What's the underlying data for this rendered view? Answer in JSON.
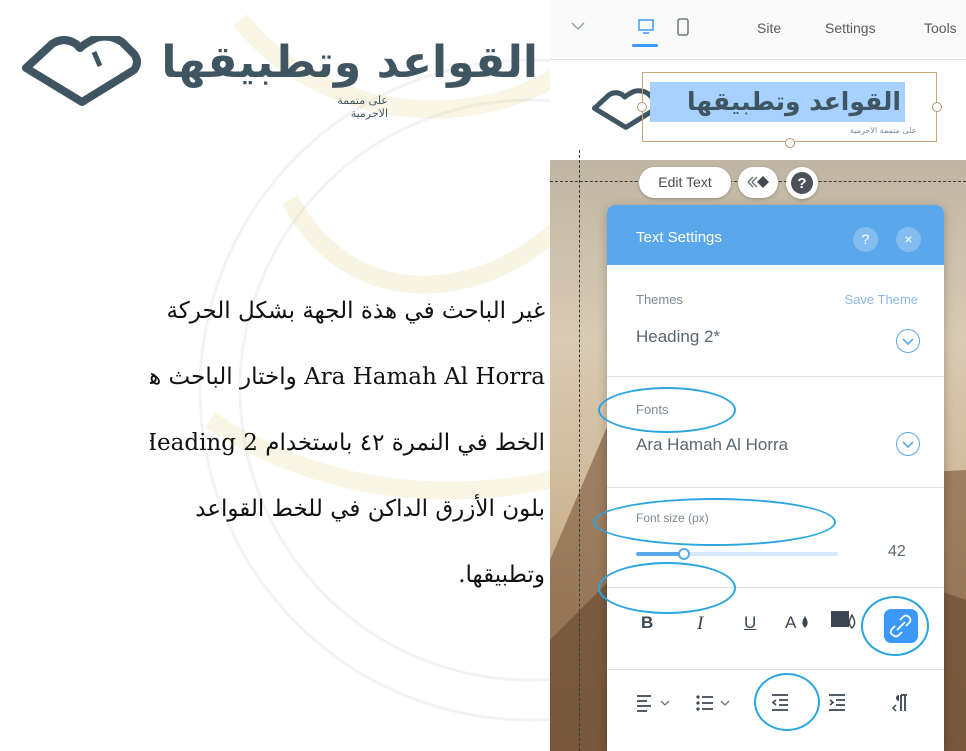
{
  "logo": {
    "title": "القواعد وتطبيقها",
    "subtitle": "على متممة الاجرمية"
  },
  "paragraph": {
    "line1": "غير الباحث في هذة الجهة بشكل الحركة",
    "line2": "Ara Hamah Al Horra واختار الباحث هجم",
    "line3": "الخط في النمرة ٤٢ باستخدام Heading 2.",
    "line4": "بلون الأزرق الداكن في للخط القواعد",
    "line5": "وتطبيقها."
  },
  "topbar": {
    "menu": [
      "Site",
      "Settings",
      "Tools"
    ]
  },
  "canvas": {
    "selected_text": "القواعد وتطبيقها",
    "selected_sub": "على متممة الاجرمية"
  },
  "toolbar_pills": {
    "edit_text": "Edit Text",
    "help": "?"
  },
  "panel": {
    "title": "Text Settings",
    "help": "?",
    "close": "×",
    "themes_label": "Themes",
    "save_theme": "Save Theme",
    "theme_value": "Heading 2*",
    "fonts_label": "Fonts",
    "font_value": "Ara Hamah Al Horra",
    "font_size_label": "Font size (px)",
    "font_size_value": "42",
    "font_size_slider_fraction": 0.24,
    "format": {
      "bold": "B",
      "italic": "I",
      "underline": "U",
      "color": "A"
    }
  },
  "colors": {
    "accent": "#3b99fc",
    "panel_header": "#5aa7eb",
    "logo": "#3f5561",
    "highlight_ring": "#2aa5e2"
  },
  "icons": [
    "chevron-down-icon",
    "desktop-icon",
    "mobile-icon",
    "animation-icon",
    "help-icon",
    "close-icon",
    "dropdown-icon",
    "text-color-icon",
    "highlight-icon",
    "link-icon",
    "align-icon",
    "list-icon",
    "indent-decrease-icon",
    "indent-increase-icon",
    "text-direction-icon"
  ]
}
